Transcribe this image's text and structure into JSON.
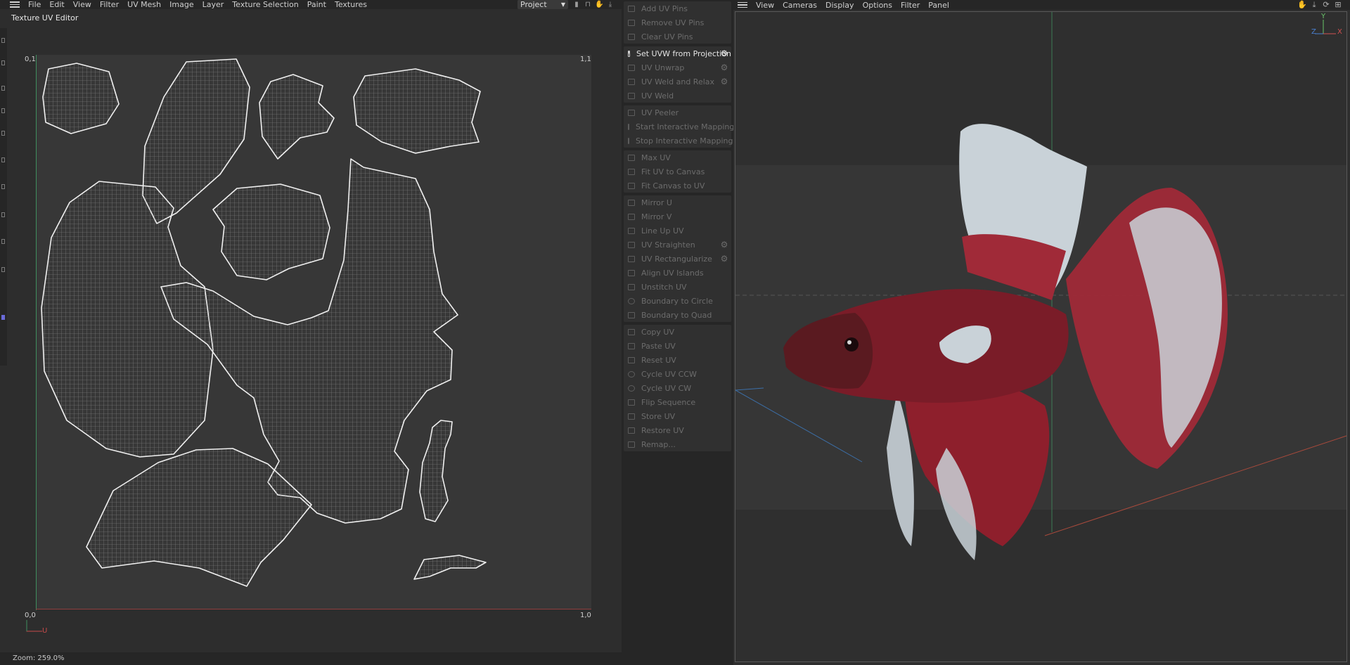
{
  "uv_editor": {
    "menu": [
      "File",
      "Edit",
      "View",
      "Filter",
      "UV Mesh",
      "Image",
      "Layer",
      "Texture Selection",
      "Paint",
      "Textures"
    ],
    "project_select": "Project",
    "title": "Texture UV Editor",
    "corner_top_left": "0,1",
    "corner_top_right": "1,1",
    "corner_bottom_left": "0,0",
    "corner_bottom_right": "1,0",
    "axis_u": "U",
    "zoom": "Zoom: 259.0%"
  },
  "commands": {
    "groups": [
      [
        "Add UV Pins",
        "Remove UV Pins",
        "Clear UV Pins"
      ],
      [
        "Set UVW from Projection",
        "UV Unwrap",
        "UV Weld and Relax",
        "UV Weld"
      ],
      [
        "UV Peeler",
        "Start Interactive Mapping",
        "Stop Interactive Mapping"
      ],
      [
        "Max UV",
        "Fit UV to Canvas",
        "Fit Canvas to UV"
      ],
      [
        "Mirror U",
        "Mirror V",
        "Line Up UV",
        "UV Straighten",
        "UV Rectangularize",
        "Align UV Islands",
        "Unstitch UV",
        "Boundary to Circle",
        "Boundary to Quad"
      ],
      [
        "Copy UV",
        "Paste UV",
        "Reset UV",
        "Cycle UV CCW",
        "Cycle UV CW",
        "Flip Sequence",
        "Store UV",
        "Restore UV",
        "Remap..."
      ]
    ]
  },
  "viewport": {
    "menu": [
      "View",
      "Cameras",
      "Display",
      "Options",
      "Filter",
      "Panel"
    ],
    "axis_y": "Y",
    "axis_z": "Z",
    "axis_x": "X"
  },
  "colors": {
    "accent_green": "#3f8e5f",
    "accent_red": "#8e3f3f",
    "fish_red": "#8e1f2c",
    "fish_white": "#c9d2d8"
  }
}
